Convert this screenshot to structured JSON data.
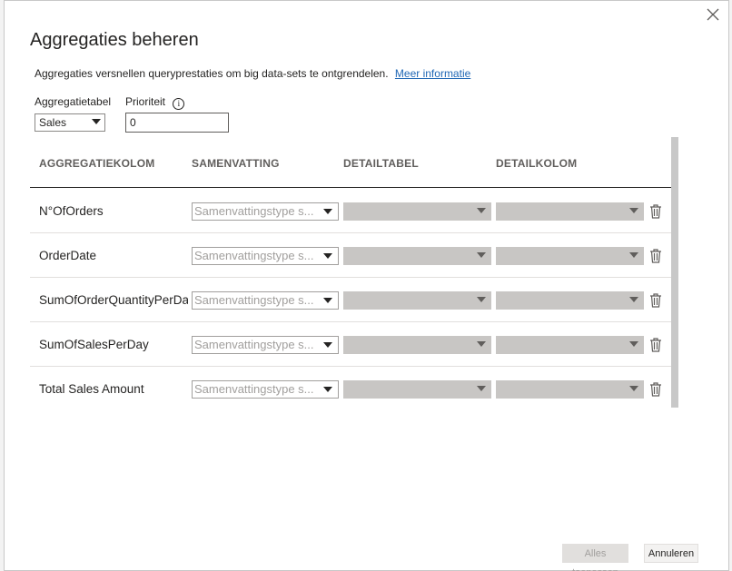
{
  "dialog": {
    "title": "Aggregaties beheren",
    "description": "Aggregaties versnellen queryprestaties om big data-sets te ontgrendelen.",
    "learn_more": "Meer informatie",
    "close_icon": "close-icon",
    "aggregation_table_label": "Aggregatietabel",
    "aggregation_table_value": "Sales",
    "priority_label": "Prioriteit",
    "priority_info_icon": "info-icon",
    "priority_value": "0"
  },
  "grid": {
    "headers": [
      "AGGREGATIEKOLOM",
      "SAMENVATTING",
      "DETAILTABEL",
      "DETAILKOLOM"
    ],
    "rows": [
      {
        "name": "N°OfOrders",
        "summary": "Samenvattingstype s...",
        "detail_table": "",
        "detail_column": ""
      },
      {
        "name": "OrderDate",
        "summary": "Samenvattingstype s...",
        "detail_table": "",
        "detail_column": ""
      },
      {
        "name": "SumOfOrderQuantityPerDay",
        "summary": "Samenvattingstype s...",
        "detail_table": "",
        "detail_column": ""
      },
      {
        "name": "SumOfSalesPerDay",
        "summary": "Samenvattingstype s...",
        "detail_table": "",
        "detail_column": ""
      },
      {
        "name": "Total Sales Amount",
        "summary": "Samenvattingstype s...",
        "detail_table": "",
        "detail_column": ""
      }
    ]
  },
  "footer": {
    "apply_label": "Alles toepassen",
    "cancel_label": "Annuleren"
  },
  "colors": {
    "link": "#2168b5",
    "disabled_dropdown": "#c8c6c4",
    "text": "#252423"
  }
}
